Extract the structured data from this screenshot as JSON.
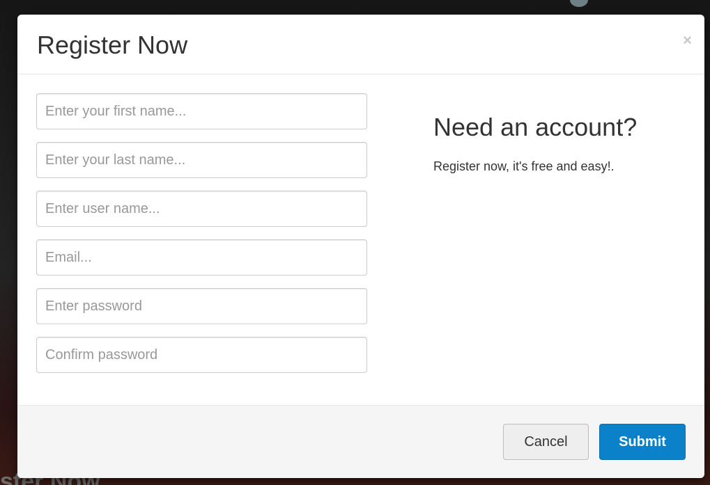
{
  "modal": {
    "title": "Register Now",
    "close_symbol": "×"
  },
  "form": {
    "first_name_placeholder": "Enter your first name...",
    "last_name_placeholder": "Enter your last name...",
    "username_placeholder": "Enter user name...",
    "email_placeholder": "Email...",
    "password_placeholder": "Enter password",
    "confirm_password_placeholder": "Confirm password"
  },
  "info": {
    "title": "Need an account?",
    "text": "Register now, it's free and easy!."
  },
  "footer": {
    "cancel_label": "Cancel",
    "submit_label": "Submit"
  },
  "background": {
    "bottom_text": "ster Now"
  },
  "colors": {
    "primary": "#0a81c9",
    "backdrop": "#1b1b1b"
  }
}
